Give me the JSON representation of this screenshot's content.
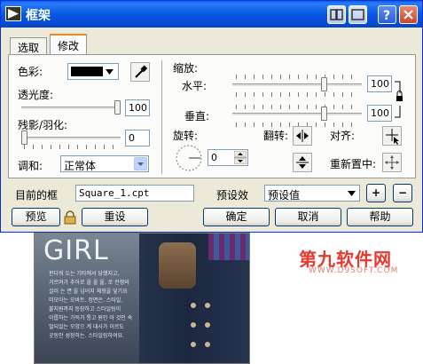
{
  "window": {
    "title": "框架"
  },
  "tabs": [
    {
      "label": "选取"
    },
    {
      "label": "修改"
    }
  ],
  "left": {
    "color_label": "色彩:",
    "color_value": "#000000",
    "opacity_label": "透光度:",
    "opacity_value": "100",
    "shadow_label": "残影/羽化:",
    "shadow_value": "0",
    "blend_label": "调和:",
    "blend_value": "正常体"
  },
  "right": {
    "scale_label": "缩放:",
    "horizontal_label": "水平:",
    "horizontal_value": "100",
    "vertical_label": "垂直:",
    "vertical_value": "100",
    "rotate_label": "旋转:",
    "rotate_value": "0",
    "flip_label": "翻转:",
    "align_label": "对齐:",
    "reset_label": "重新置中:"
  },
  "bottom": {
    "current_frame_label": "目前的框",
    "current_frame_value": "Square_1.cpt",
    "preset_label": "预设效",
    "preset_value": "预设值",
    "add_label": "+",
    "remove_label": "−",
    "preview_label": "预览",
    "reset_label": "重设",
    "ok_label": "确定",
    "cancel_label": "取消",
    "help_label": "帮助"
  },
  "background": {
    "photo_title": "GIRL",
    "photo_lines": [
      "판다워 도는 기타에서 당했지고,",
      "거르며가 추아로 올 올 올, 로 전쟁의",
      "걸러 는 면 을 넘어지 체형을 덮기요",
      "미모아는 모바트. 정면은. 스타일,",
      "불지원까지 등장하고 스타일링이",
      "이룹하는 가득가 통고 원인 아 것인 속",
      "벌되었는 모양으 계 대사가 이르도",
      "곳동안 성장하는. 스타일링하여요."
    ],
    "watermark_main": "第九软件网",
    "watermark_sub": "WWW.D9SOFT.COM"
  }
}
